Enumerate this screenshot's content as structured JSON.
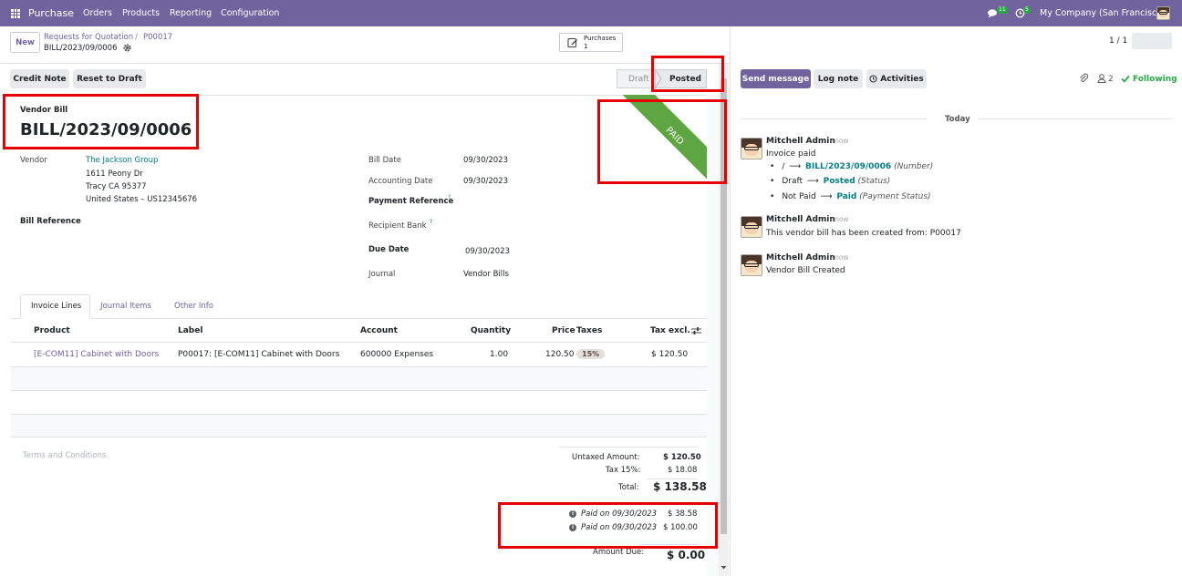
{
  "navbar": {
    "app_name": "Purchase",
    "menu": [
      "Orders",
      "Products",
      "Reporting",
      "Configuration"
    ],
    "messages_count": "11",
    "activities_count": "5",
    "company": "My Company (San Francisco)"
  },
  "control": {
    "new_label": "New",
    "breadcrumb_parent": "Requests for Quotation",
    "breadcrumb_sep": "/",
    "breadcrumb_current": "P00017",
    "record_name": "BILL/2023/09/0006",
    "smart_button_label": "Purchases",
    "smart_button_count": "1",
    "pager": "1 / 1"
  },
  "actions": {
    "credit_note": "Credit Note",
    "reset_to_draft": "Reset to Draft",
    "status_draft": "Draft",
    "status_posted": "Posted"
  },
  "form": {
    "doc_type": "Vendor Bill",
    "doc_name": "BILL/2023/09/0006",
    "ribbon": "PAID",
    "vendor_label": "Vendor",
    "vendor_name": "The Jackson Group",
    "vendor_address_1": "1611 Peony Dr",
    "vendor_address_2": "Tracy CA 95377",
    "vendor_address_3": "United States – US12345676",
    "bill_reference_label": "Bill Reference",
    "bill_date_label": "Bill Date",
    "bill_date": "09/30/2023",
    "accounting_date_label": "Accounting Date",
    "accounting_date": "09/30/2023",
    "payment_reference_label": "Payment Reference",
    "recipient_bank_label": "Recipient Bank",
    "help_mark": "?",
    "due_date_label": "Due Date",
    "due_date": "09/30/2023",
    "journal_label": "Journal",
    "journal": "Vendor Bills"
  },
  "tabs": [
    "Invoice Lines",
    "Journal Items",
    "Other Info"
  ],
  "lines": {
    "headers": {
      "product": "Product",
      "label": "Label",
      "account": "Account",
      "quantity": "Quantity",
      "price": "Price",
      "taxes": "Taxes",
      "tax_excl": "Tax excl."
    },
    "rows": [
      {
        "product": "[E-COM11] Cabinet with Doors",
        "label": "P00017: [E-COM11] Cabinet with Doors",
        "account": "600000 Expenses",
        "quantity": "1.00",
        "price": "120.50",
        "tax": "15%",
        "subtotal": "$ 120.50"
      }
    ]
  },
  "terms_placeholder": "Terms and Conditions",
  "totals": {
    "untaxed_label": "Untaxed Amount:",
    "untaxed": "$ 120.50",
    "tax_label": "Tax 15%:",
    "tax": "$ 18.08",
    "total_label": "Total:",
    "total": "$ 138.58",
    "payments": [
      {
        "label": "Paid on 09/30/2023",
        "amount": "$ 38.58"
      },
      {
        "label": "Paid on 09/30/2023",
        "amount": "$ 100.00"
      }
    ],
    "amount_due_label": "Amount Due:",
    "amount_due": "$ 0.00"
  },
  "chatter": {
    "send_message": "Send message",
    "log_note": "Log note",
    "activities": "Activities",
    "followers_count": "2",
    "following": "Following",
    "today": "Today",
    "messages": [
      {
        "author": "Mitchell Admin",
        "time": "- now",
        "body": "Invoice paid",
        "changes": [
          {
            "old": "/",
            "arrow": "⟶",
            "new": "BILL/2023/09/0006",
            "field": "(Number)"
          },
          {
            "old": "Draft",
            "arrow": "⟶",
            "new": "Posted",
            "field": "(Status)"
          },
          {
            "old": "Not Paid",
            "arrow": "⟶",
            "new": "Paid",
            "field": "(Payment Status)"
          }
        ]
      },
      {
        "author": "Mitchell Admin",
        "time": "- now",
        "body": "This vendor bill has been created from: P00017"
      },
      {
        "author": "Mitchell Admin",
        "time": "- now",
        "body": "Vendor Bill Created"
      }
    ]
  },
  "colors": {
    "brand": "#71639e",
    "link": "#017e84",
    "paid_ribbon": "#5ea642",
    "highlight": "#e60000"
  }
}
